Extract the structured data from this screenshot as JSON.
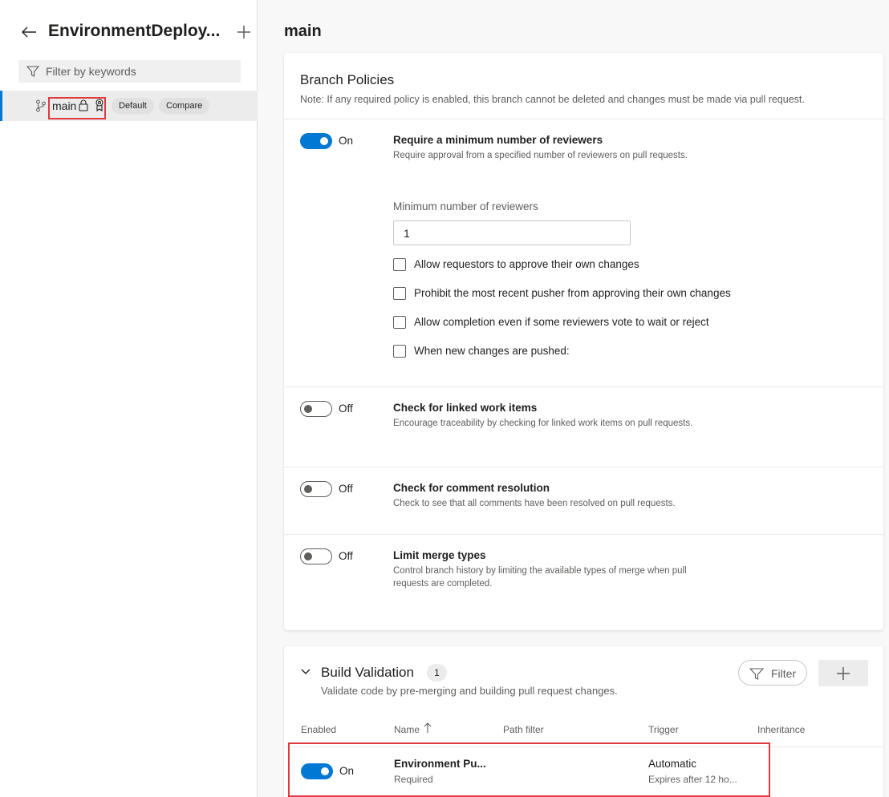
{
  "sidebar": {
    "back_icon": "arrow-left-icon",
    "repo_title": "EnvironmentDeploy...",
    "add_icon": "plus-icon",
    "filter": {
      "placeholder": "Filter by keywords",
      "value": "",
      "icon": "filter-icon"
    },
    "branch": {
      "name": "main",
      "icon": "git-branch-icon",
      "lock_icon": "lock-icon",
      "policy_icon": "policy-badge-icon",
      "default_label": "Default",
      "compare_label": "Compare"
    }
  },
  "main": {
    "title": "main",
    "branch_policies": {
      "title": "Branch Policies",
      "note": "Note: If any required policy is enabled, this branch cannot be deleted and changes must be made via pull request.",
      "policies": [
        {
          "state": "On",
          "enabled": true,
          "title": "Require a minimum number of reviewers",
          "description": "Require approval from a specified number of reviewers on pull requests.",
          "min_reviewers_label": "Minimum number of reviewers",
          "min_reviewers_value": "1",
          "options": [
            "Allow requestors to approve their own changes",
            "Prohibit the most recent pusher from approving their own changes",
            "Allow completion even if some reviewers vote to wait or reject",
            "When new changes are pushed:"
          ]
        },
        {
          "state": "Off",
          "enabled": false,
          "title": "Check for linked work items",
          "description": "Encourage traceability by checking for linked work items on pull requests."
        },
        {
          "state": "Off",
          "enabled": false,
          "title": "Check for comment resolution",
          "description": "Check to see that all comments have been resolved on pull requests."
        },
        {
          "state": "Off",
          "enabled": false,
          "title": "Limit merge types",
          "description": "Control branch history by limiting the available types of merge when pull requests are completed."
        }
      ]
    },
    "build_validation": {
      "chevron_icon": "chevron-down-icon",
      "title": "Build Validation",
      "count": "1",
      "description": "Validate code by pre-merging and building pull request changes.",
      "filter_label": "Filter",
      "filter_icon": "filter-icon",
      "add_icon": "plus-icon",
      "columns": [
        "Enabled",
        "Name",
        "Path filter",
        "Trigger",
        "Inheritance"
      ],
      "sort_icon": "arrow-up-icon",
      "rows": [
        {
          "enabled": true,
          "state": "On",
          "name": "Environment Pu...",
          "requirement": "Required",
          "path_filter": "",
          "trigger": "Automatic",
          "expiry": "Expires after 12 ho...",
          "inheritance": ""
        }
      ]
    }
  },
  "colors": {
    "accent": "#0078d4",
    "highlight": "#e0393e"
  }
}
